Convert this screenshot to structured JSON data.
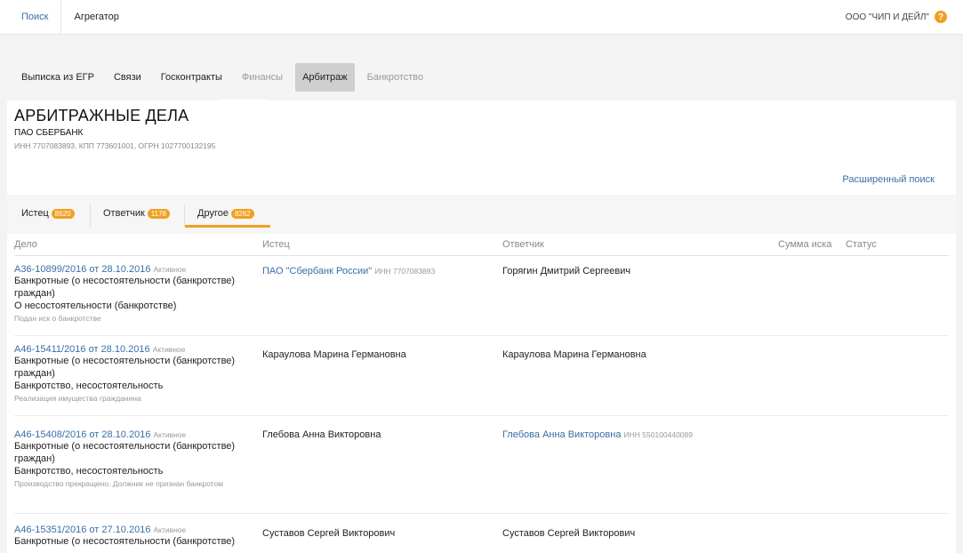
{
  "topnav": {
    "search": "Поиск",
    "aggregator": "Агрегатор",
    "company": "ООО \"ЧИП И ДЕЙЛ\"",
    "help": "?"
  },
  "sections": [
    {
      "label": "Выписка из ЕГР"
    },
    {
      "label": "Связи"
    },
    {
      "label": "Госконтракты"
    },
    {
      "label": "Финансы"
    },
    {
      "label": "Арбитраж"
    },
    {
      "label": "Банкротство"
    }
  ],
  "page": {
    "title": "АРБИТРАЖНЫЕ ДЕЛА",
    "company_name": "ПАО СБЕРБАНК",
    "ids": "ИНН 7707083893, КПП 773601001, ОГРН 1027700132195",
    "advanced_search": "Расширенный поиск"
  },
  "party_tabs": [
    {
      "label": "Истец",
      "count": "8620"
    },
    {
      "label": "Ответчик",
      "count": "1178"
    },
    {
      "label": "Другое",
      "count": "8262"
    }
  ],
  "table": {
    "headers": {
      "case": "Дело",
      "plaintiff": "Истец",
      "defendant": "Ответчик",
      "amount": "Сумма иска",
      "status": "Статус"
    },
    "rows": [
      {
        "case_no": "А36-10899/2016 от 28.10.2016",
        "state": "Активное",
        "cat1": "Банкротные (о несостоятельности (банкротстве) граждан)",
        "cat2": "О несостоятельности (банкротстве)",
        "note": "Подан иск о банкротстве",
        "plaintiff": "ПАО \"Сбербанк России\"",
        "plaintiff_inn": "ИНН 7707083893",
        "defendant": "Горягин Дмитрий Сергеевич",
        "defendant_inn": ""
      },
      {
        "case_no": "А46-15411/2016 от 28.10.2016",
        "state": "Активное",
        "cat1": "Банкротные (о несостоятельности (банкротстве) граждан)",
        "cat2": "Банкротство, несостоятельность",
        "note": "Реализация имущества гражданина",
        "plaintiff": "Караулова Марина Германовна",
        "plaintiff_inn": "",
        "defendant": "Караулова Марина Германовна",
        "defendant_inn": ""
      },
      {
        "case_no": "А46-15408/2016 от 28.10.2016",
        "state": "Активное",
        "cat1": "Банкротные (о несостоятельности (банкротстве) граждан)",
        "cat2": "Банкротство, несостоятельность",
        "note": "Производство прекращено. Должник не признан банкротом",
        "plaintiff": "Глебова Анна Викторовна",
        "plaintiff_inn": "",
        "defendant": "Глебова Анна Викторовна",
        "defendant_inn": "ИНН 550100440089"
      },
      {
        "case_no": "А46-15351/2016 от 27.10.2016",
        "state": "Активное",
        "cat1": "Банкротные (о несостоятельности (банкротстве)",
        "cat2": "",
        "note": "",
        "plaintiff": "Суставов Сергей Викторович",
        "plaintiff_inn": "",
        "defendant": "Суставов Сергей Викторович",
        "defendant_inn": ""
      }
    ]
  },
  "colors": {
    "link": "#3a6ea5",
    "accent": "#f0a020"
  }
}
